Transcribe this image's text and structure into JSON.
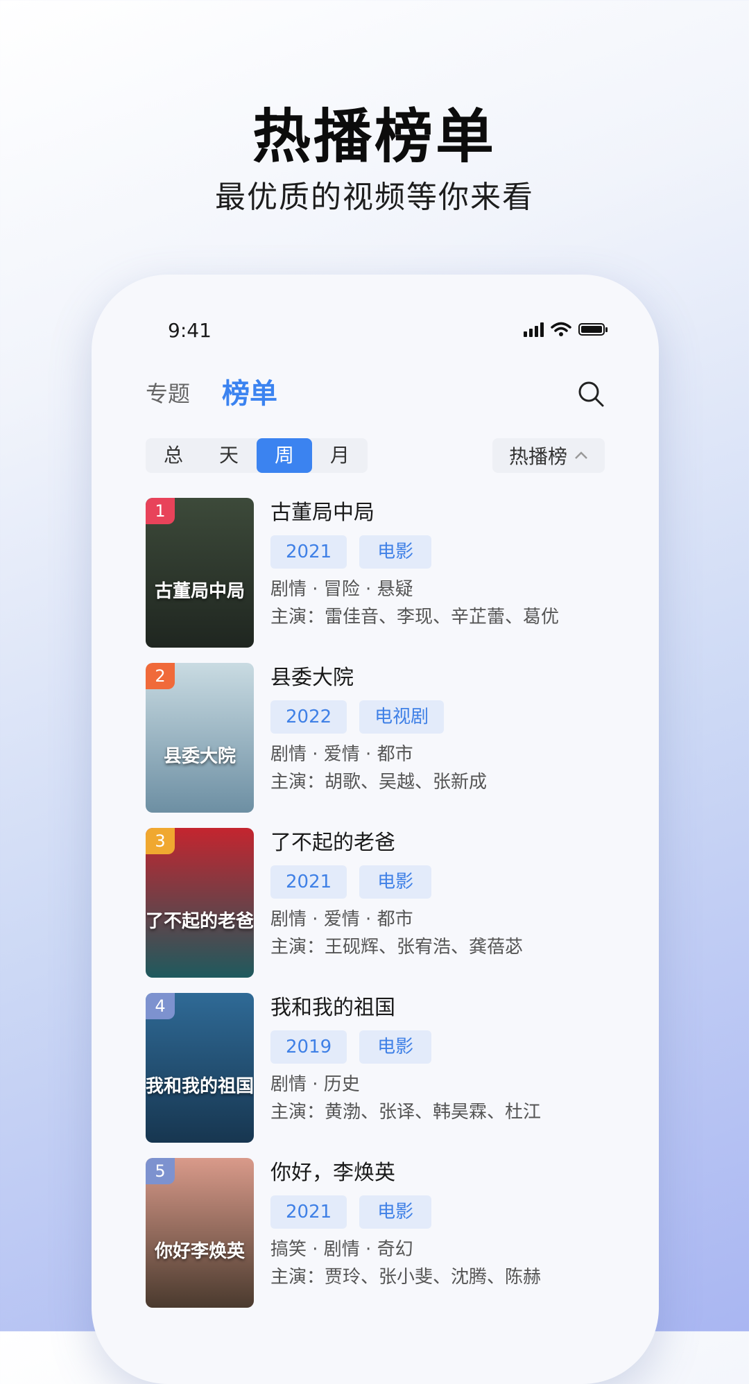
{
  "hero": {
    "title": "热播榜单",
    "subtitle": "最优质的视频等你来看"
  },
  "status_bar": {
    "time": "9:41"
  },
  "nav": {
    "tab_topics": "专题",
    "tab_ranking": "榜单"
  },
  "segments": [
    "总",
    "天",
    "周",
    "月"
  ],
  "active_segment": "周",
  "rank_dropdown": {
    "label": "热播榜"
  },
  "list": [
    {
      "rank": "1",
      "title": "古董局中局",
      "year": "2021",
      "kind": "电影",
      "genres": "剧情 · 冒险 · 悬疑",
      "cast": "主演：雷佳音、李现、辛芷蕾、葛优",
      "poster_text": "古董局中局",
      "rank_color": "#e8435a",
      "poster_colors": [
        "#3d4a3a",
        "#1f2620"
      ]
    },
    {
      "rank": "2",
      "title": "县委大院",
      "year": "2022",
      "kind": "电视剧",
      "genres": "剧情 · 爱情 · 都市",
      "cast": "主演：胡歌、吴越、张新成",
      "poster_text": "县委大院",
      "rank_color": "#f06a3a",
      "poster_colors": [
        "#c9dbe2",
        "#6d8fa3"
      ]
    },
    {
      "rank": "3",
      "title": "了不起的老爸",
      "year": "2021",
      "kind": "电影",
      "genres": "剧情 · 爱情 · 都市",
      "cast": "主演：王砚辉、张宥浩、龚蓓苾",
      "poster_text": "了不起的老爸",
      "rank_color": "#f0a830",
      "poster_colors": [
        "#c4252f",
        "#1e5a5e"
      ]
    },
    {
      "rank": "4",
      "title": "我和我的祖国",
      "year": "2019",
      "kind": "电影",
      "genres": "剧情 · 历史",
      "cast": "主演：黄渤、张译、韩昊霖、杜江",
      "poster_text": "我和我的祖国",
      "rank_color": "#7d92cf",
      "poster_colors": [
        "#2f6a96",
        "#173650"
      ]
    },
    {
      "rank": "5",
      "title": "你好，李焕英",
      "year": "2021",
      "kind": "电影",
      "genres": "搞笑 · 剧情 · 奇幻",
      "cast": "主演：贾玲、张小斐、沈腾、陈赫",
      "poster_text": "你好李焕英",
      "rank_color": "#7d92cf",
      "poster_colors": [
        "#d99a8a",
        "#4a3a2e"
      ]
    }
  ],
  "icons": {
    "search": "search-icon",
    "signal": "signal-icon",
    "wifi": "wifi-icon",
    "battery": "battery-icon",
    "chevron": "chevron-up-icon"
  },
  "colors": {
    "accent": "#3b83f0",
    "tag_bg": "#e3ebfa"
  }
}
